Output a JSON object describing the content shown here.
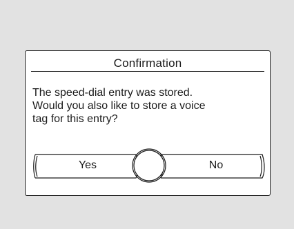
{
  "dialog": {
    "title": "Confirmation",
    "message": "The speed-dial entry was stored.\nWould you also like to store a voice\ntag for this entry?",
    "yes_label": "Yes",
    "no_label": "No",
    "selected": "No"
  },
  "colors": {
    "background": "#e2e2e2",
    "dialog": "#ffffff",
    "ink": "#1a1a1a"
  }
}
